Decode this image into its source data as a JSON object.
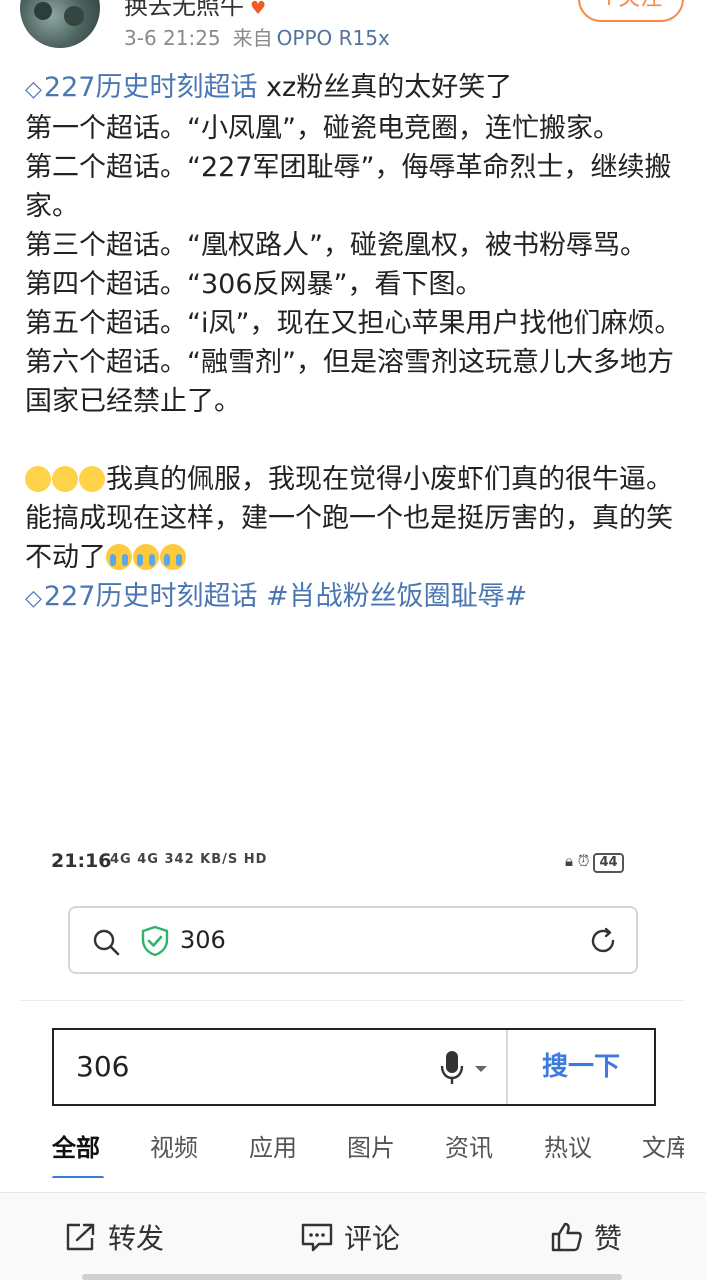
{
  "header": {
    "username": "换去无照牛",
    "badge": "",
    "timestamp": "3-6 21:25",
    "source_prefix": "来自",
    "device": "OPPO R15x",
    "follow_label": "+关注"
  },
  "post": {
    "lines": [
      {
        "topic": "227历史时刻超话",
        "text": " xz粉丝真的太好笑了"
      },
      {
        "text": "第一个超话。“小凤凰”，碰瓷电竞圈，连忙搬家。"
      },
      {
        "text": "第二个超话。“227军团耻辱”，侮辱革命烈士，继续搬家。"
      },
      {
        "text": "第三个超话。“凰权路人”，碰瓷凰权，被书粉辱骂。"
      },
      {
        "text": "第四个超话。“306反网暴”，看下图。"
      },
      {
        "text": "第五个超话。“i凤”，现在又担心苹果用户找他们麻烦。"
      },
      {
        "text": "第六个超话。“融雪剂”，但是溶雪剂这玩意儿大多地方国家已经禁止了。"
      }
    ],
    "para2_text": "我真的佩服，我现在觉得小废虾们真的很牛逼。能搞成现在这样，建一个跑一个也是挺厉害的，真的笑不动了",
    "footer_topic1": "227历史时刻超话",
    "footer_topic2": "#肖战粉丝饭圈耻辱#"
  },
  "screenshot": {
    "status_time": "21:16",
    "status_icons": "4G 4G 342 KB/S HD",
    "battery": "44",
    "url_text": "306",
    "search_query": "306",
    "search_button": "搜一下",
    "tabs": [
      "全部",
      "视频",
      "应用",
      "图片",
      "资讯",
      "热议",
      "文库"
    ]
  },
  "actions": {
    "repost": "转发",
    "comment": "评论",
    "like": "赞"
  },
  "colors": {
    "topic": "#4a77b3",
    "follow": "#f28c48",
    "search_accent": "#3b7be0"
  }
}
